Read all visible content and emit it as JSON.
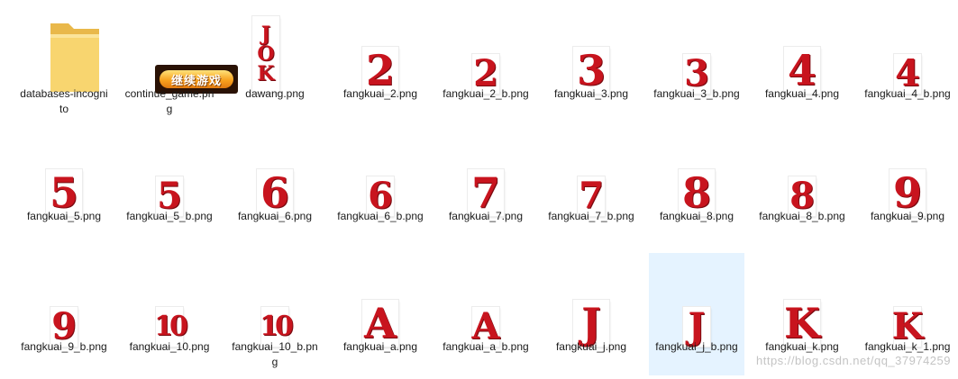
{
  "files": [
    {
      "name": "databases-incognito",
      "type": "folder"
    },
    {
      "name": "continue_game.png",
      "type": "button",
      "text": "继续游戏"
    },
    {
      "name": "dawang.png",
      "type": "joker",
      "letters": [
        "J",
        "O",
        "K"
      ]
    },
    {
      "name": "fangkuai_2.png",
      "type": "card",
      "rank": "2"
    },
    {
      "name": "fangkuai_2_b.png",
      "type": "card",
      "rank": "2"
    },
    {
      "name": "fangkuai_3.png",
      "type": "card",
      "rank": "3"
    },
    {
      "name": "fangkuai_3_b.png",
      "type": "card",
      "rank": "3"
    },
    {
      "name": "fangkuai_4.png",
      "type": "card",
      "rank": "4"
    },
    {
      "name": "fangkuai_4_b.png",
      "type": "card",
      "rank": "4"
    },
    {
      "name": "fangkuai_5.png",
      "type": "card",
      "rank": "5"
    },
    {
      "name": "fangkuai_5_b.png",
      "type": "card",
      "rank": "5"
    },
    {
      "name": "fangkuai_6.png",
      "type": "card",
      "rank": "6"
    },
    {
      "name": "fangkuai_6_b.png",
      "type": "card",
      "rank": "6"
    },
    {
      "name": "fangkuai_7.png",
      "type": "card",
      "rank": "7"
    },
    {
      "name": "fangkuai_7_b.png",
      "type": "card",
      "rank": "7"
    },
    {
      "name": "fangkuai_8.png",
      "type": "card",
      "rank": "8"
    },
    {
      "name": "fangkuai_8_b.png",
      "type": "card",
      "rank": "8"
    },
    {
      "name": "fangkuai_9.png",
      "type": "card",
      "rank": "9"
    },
    {
      "name": "fangkuai_9_b.png",
      "type": "card",
      "rank": "9"
    },
    {
      "name": "fangkuai_10.png",
      "type": "card",
      "rank": "10"
    },
    {
      "name": "fangkuai_10_b.png",
      "type": "card",
      "rank": "10"
    },
    {
      "name": "fangkuai_a.png",
      "type": "card",
      "rank": "A"
    },
    {
      "name": "fangkuai_a_b.png",
      "type": "card",
      "rank": "A"
    },
    {
      "name": "fangkuai_j.png",
      "type": "card",
      "rank": "J"
    },
    {
      "name": "fangkuai_j_b.png",
      "type": "card",
      "rank": "J",
      "selected": true
    },
    {
      "name": "fangkuai_k.png",
      "type": "card",
      "rank": "K"
    },
    {
      "name": "fangkuai_k_1.png",
      "type": "card",
      "rank": "K"
    }
  ],
  "watermark": "https://blog.csdn.net/qq_37974259",
  "colors": {
    "card_red": "#c8141e",
    "selection": "#e5f3ff",
    "folder": "#f6cf62"
  }
}
